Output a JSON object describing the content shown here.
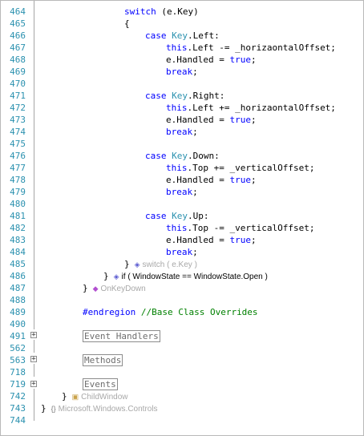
{
  "editor": {
    "line_numbers": [
      "464",
      "465",
      "466",
      "467",
      "468",
      "469",
      "470",
      "471",
      "472",
      "473",
      "474",
      "475",
      "476",
      "477",
      "478",
      "479",
      "480",
      "481",
      "482",
      "483",
      "484",
      "485",
      "486",
      "487",
      "488",
      "489",
      "490",
      "491",
      "562",
      "563",
      "718",
      "719",
      "742",
      "743",
      "744"
    ],
    "collapse_markers": [
      "+",
      "+",
      "+"
    ],
    "code": {
      "l464_kw": "switch",
      "l464_rest": " (e.Key)",
      "l465": "{",
      "case_kw": "case",
      "key_type": "Key",
      "left_member": ".Left:",
      "this_kw": "this",
      "l467_rest": ".Left -= _horizaontalOffset;",
      "handled": "e.Handled = ",
      "true_kw": "true",
      "semicolon": ";",
      "break_kw": "break",
      "right_member": ".Right:",
      "l472_rest": ".Left += _horizaontalOffset;",
      "down_member": ".Down:",
      "l477_rest": ".Top += _verticalOffset;",
      "up_member": ".Up:",
      "l482_rest": ".Top -= _verticalOffset;",
      "close_brace": "}",
      "l489_directive": "#endregion",
      "l489_comment": " //Base Class Overrides",
      "region_event_handlers": "Event Handlers",
      "region_methods": "Methods",
      "region_events": "Events"
    },
    "hints": {
      "switch_hint": "switch ( e.Key )",
      "if_hint": "if ( WindowState == WindowState.Open )",
      "method_hint": "OnKeyDown",
      "class_hint": "ChildWindow",
      "namespace_hint": "Microsoft.Windows.Controls",
      "switch_icon": "c#-block-icon",
      "if_icon": "c#-block-icon",
      "method_icon": "method-icon",
      "class_icon": "class-icon",
      "namespace_icon": "namespace-icon"
    },
    "colors": {
      "keyword": "#0000ff",
      "type": "#2b91af",
      "comment": "#008000",
      "line_number": "#2b91af",
      "hint": "#a8a8a8"
    }
  }
}
